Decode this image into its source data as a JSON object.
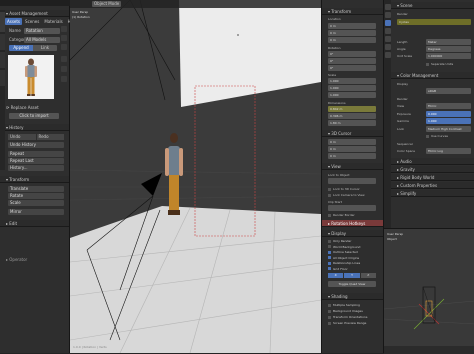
{
  "left_panel": {
    "header": "Asset Management",
    "tabs": [
      "Assets",
      "Scenes",
      "Materials",
      "HDRI"
    ],
    "name_label": "Name",
    "name_value": "Rotation",
    "category_label": "Category",
    "category_value": "All Models",
    "append_button": "Append",
    "link_button": "Link",
    "replace_asset": "Replace Asset",
    "click_to_import": "Click to import",
    "history_header": "History",
    "history_undo": "Undo",
    "history_redo": "Redo",
    "history_undo_history": "Undo History",
    "repeat_items": [
      "Repeat",
      "Repeat Last",
      "History..."
    ],
    "transform_header": "Transform",
    "transform_items": [
      "Translate",
      "Rotate",
      "Scale",
      "Mirror"
    ],
    "edit_header": "Edit",
    "operator_label": "Operator"
  },
  "viewport": {
    "header_items": [
      "User Persp",
      "(1) Rotation"
    ],
    "object_mode": "Object Mode",
    "status_text": "1.0.0 | Rotation | Verts"
  },
  "n_panel": {
    "transform_header": "Transform",
    "location_label": "Location",
    "rotation_label": "Rotation",
    "scale_label": "Scale",
    "dimensions_label": "Dimensions",
    "xyz_values": [
      "0 m",
      "0 m",
      "0 m"
    ],
    "rotation_values": [
      "0°",
      "0°",
      "0°"
    ],
    "scale_values": [
      "1.000",
      "1.000",
      "1.000"
    ],
    "dimensions_values": [
      "0.842 m",
      "0.396 m",
      "1.80 m"
    ],
    "cursor_header": "3D Cursor",
    "view_header": "View",
    "lock_label": "Lock to Object",
    "lock_cursor": "Lock to 3D Cursor",
    "lock_camera": "Lock Camera to View",
    "clip_label": "Clip Start",
    "render_border": "Render Border",
    "rotation_header": "Rotation Hotkeys"
  },
  "display_panel": {
    "header": "Display",
    "items": [
      "Only Render",
      "World Background",
      "Outline Selected",
      "All Object Origins",
      "Relationship Lines",
      "Grid Floor",
      "X",
      "Y",
      "Z"
    ],
    "toggle_quad": "Toggle Quad View",
    "shading_header": "Shading",
    "shading_items": [
      "Multiple Sampling",
      "Background Images",
      "Transform Orientations",
      "Screen Preview Range"
    ]
  },
  "properties": {
    "header": "Scene",
    "render_label": "Render",
    "render_engine": "Cycles",
    "scene_fields": [
      {
        "label": "Length",
        "value": "Meter"
      },
      {
        "label": "Angle",
        "value": "Degrees"
      },
      {
        "label": "Unit Scale",
        "value": "1.000000"
      }
    ],
    "separate_units": "Separate Units",
    "color_management_header": "Color Management",
    "display_label": "Display",
    "display_value": "sRGB",
    "render_subheader": "Render",
    "view_label": "View",
    "view_value": "Filmic",
    "exposure_label": "Exposure",
    "exposure_value": "0.000",
    "gamma_label": "Gamma",
    "gamma_value": "1.000",
    "look_label": "Look",
    "look_value": "Medium High Contrast",
    "use_curves": "Use Curves",
    "sequencer_label": "Sequencer",
    "sequencer_value": "sRGB",
    "color_space_label": "Color Space",
    "color_space_value": "Filmic Log",
    "sections": [
      "Audio",
      "Gravity",
      "Rigid Body World",
      "Custom Properties",
      "Simplify"
    ]
  },
  "mini_view": {
    "header": "User Persp",
    "sub": "Object"
  }
}
